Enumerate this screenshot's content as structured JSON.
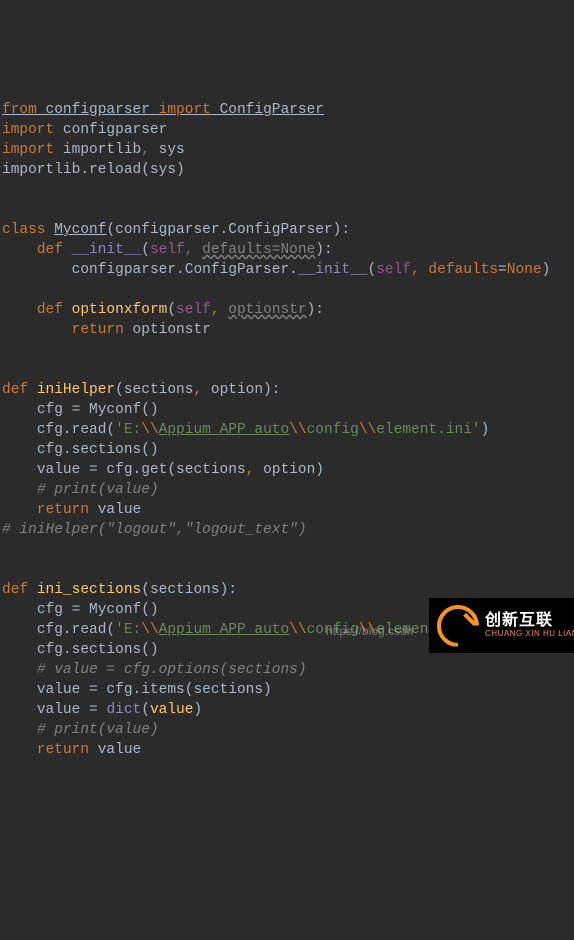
{
  "code": {
    "l1": {
      "kw": "from",
      "mod": "configparser",
      "kw2": "import",
      "cls": "ConfigParser"
    },
    "l2": {
      "kw": "import",
      "mod": "configparser"
    },
    "l3": {
      "kw": "import",
      "mod": "importlib",
      "comma": ",",
      "mod2": "sys"
    },
    "l4": "importlib.reload(sys)",
    "l7": {
      "kw": "class",
      "name": "Myconf",
      "base": "(configparser.ConfigParser):"
    },
    "l8": {
      "kw": "def",
      "name": "__init__",
      "open": "(",
      "self": "self",
      "comma": ",",
      "param": "defaults=None",
      "close": "):"
    },
    "l9": {
      "prefix": "configparser.ConfigParser.",
      "dunder": "__init__",
      "open": "(",
      "self": "self",
      "c": ", ",
      "p": "defaults",
      "eq": "=",
      "none": "None",
      "close": ")"
    },
    "l11": {
      "kw": "def",
      "name": "optionxform",
      "open": "(",
      "self": "self",
      "c": ", ",
      "param": "optionstr",
      "close": "):"
    },
    "l12": {
      "kw": "return",
      "val": "optionstr"
    },
    "l15": {
      "kw": "def",
      "name": "iniHelper",
      "open": "(",
      "p1": "sections",
      "c": ", ",
      "p2": "option",
      "close": "):"
    },
    "l16": "cfg = Myconf()",
    "l17": {
      "pre": "cfg.read(",
      "s1": "'E:",
      "e1": "\\\\",
      "s2": "Appium_APP_auto",
      "e2": "\\\\",
      "s3": "config",
      "e3": "\\\\",
      "s4": "element.ini'",
      "post": ")"
    },
    "l18": "cfg.sections()",
    "l19": {
      "pre": "value = cfg.get(sections",
      "c": ", ",
      "post": "option)"
    },
    "l20": "# print(value)",
    "l21": {
      "kw": "return",
      "val": "value"
    },
    "l22": "# iniHelper(\"logout\",\"logout_text\")",
    "l25": {
      "kw": "def",
      "name": "ini_sections",
      "open": "(",
      "p": "sections",
      "close": "):"
    },
    "l26": "cfg = Myconf()",
    "l27": {
      "pre": "cfg.read(",
      "s1": "'E:",
      "e1": "\\\\",
      "s2": "Appium_APP_auto",
      "e2": "\\\\",
      "s3": "config",
      "e3": "\\\\",
      "s4": "element.ini'",
      "post": ")"
    },
    "l28": "cfg.sections()",
    "l29": "# value = cfg.options(sections)",
    "l30": "value = cfg.items(sections)",
    "l31": {
      "pre": "value = ",
      "fn": "dict",
      "open": "(",
      "arg": "value",
      "close": ")"
    },
    "l32": "# print(value)",
    "l33": {
      "kw": "return",
      "val": "value"
    }
  },
  "watermark_url": "https://blog.csdn",
  "logo": {
    "cn": "创新互联",
    "en": "CHUANG XIN HU LIAN"
  }
}
